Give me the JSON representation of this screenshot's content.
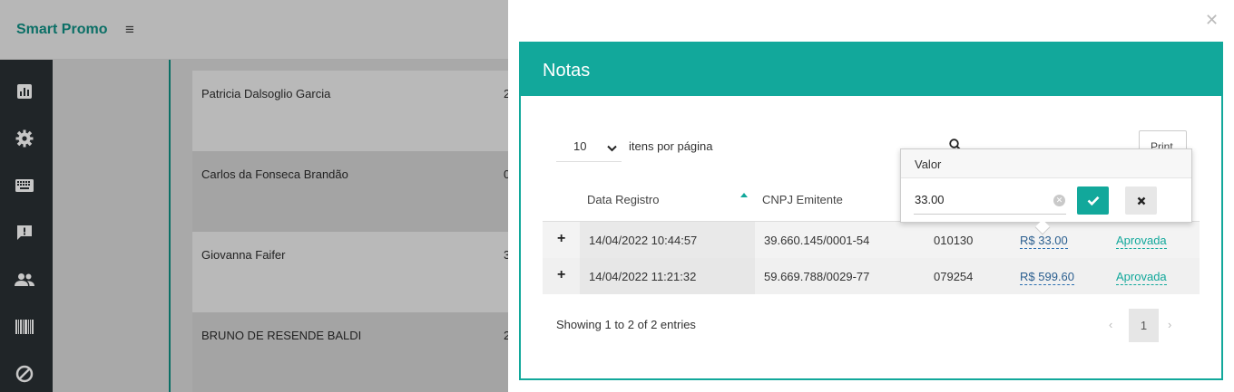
{
  "app": {
    "brand": "Smart Promo",
    "menu_icon": "hamburger-icon"
  },
  "sidebar": {
    "items": [
      {
        "icon": "chart-icon"
      },
      {
        "icon": "gear-icon"
      },
      {
        "icon": "keyboard-icon"
      },
      {
        "icon": "alert-message-icon"
      },
      {
        "icon": "users-icon"
      },
      {
        "icon": "barcode-icon"
      },
      {
        "icon": "block-icon"
      }
    ]
  },
  "background_list": {
    "rows": [
      {
        "name": "Patricia Dalsoglio Garcia",
        "frag": "2"
      },
      {
        "name": "Carlos da Fonseca Brandão",
        "frag": "0"
      },
      {
        "name": "Giovanna Faifer",
        "frag": "3"
      },
      {
        "name": "BRUNO DE RESENDE BALDI",
        "frag": "2"
      }
    ]
  },
  "modal": {
    "title": "Notas",
    "per_page_value": "10",
    "per_page_label": "itens por página",
    "print_label": "Print",
    "columns": {
      "data_registro": "Data Registro",
      "cnpj": "CNPJ Emitente"
    },
    "rows": [
      {
        "data": "14/04/2022 10:44:57",
        "cnpj": "39.660.145/0001-54",
        "numero": "010130",
        "valor": "R$ 33.00",
        "status": "Aprovada"
      },
      {
        "data": "14/04/2022 11:21:32",
        "cnpj": "59.669.788/0029-77",
        "numero": "079254",
        "valor": "R$ 599.60",
        "status": "Aprovada"
      }
    ],
    "footer": {
      "showing": "Showing 1 to 2 of 2 entries",
      "current_page": "1",
      "prev": "‹",
      "next": "›"
    }
  },
  "popover": {
    "title": "Valor",
    "value": "33.00"
  },
  "colors": {
    "accent": "#12a89b",
    "sidebar": "#202528",
    "brand": "#0b6f66"
  }
}
